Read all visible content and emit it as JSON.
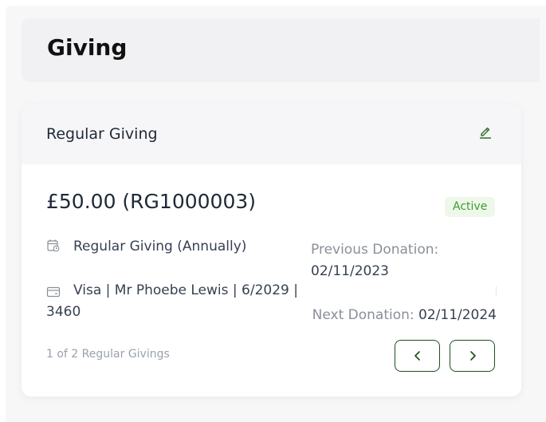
{
  "page": {
    "title": "Giving"
  },
  "card": {
    "title": "Regular Giving",
    "amount": "£50.00 (RG1000003)",
    "status": "Active",
    "frequency": "Regular Giving (Annually)",
    "payment_line1": "Visa | Mr Phoebe Lewis | 6/2029 |",
    "payment_line2": "3460",
    "previous_donation_label": "Previous Donation:",
    "previous_donation_value": "02/11/2023",
    "next_donation_label": "Next Donation:",
    "next_donation_value": "02/11/2024",
    "pager": {
      "position": "1 of 2",
      "label": "Regular Givings"
    }
  },
  "icons": {
    "edit": "pencil-icon",
    "calendar": "calendar-clock-icon",
    "card": "credit-card-icon",
    "prev": "chevron-left-icon",
    "next": "chevron-right-icon"
  },
  "colors": {
    "accent": "#1e4d1f",
    "status_bg": "#eef8ea",
    "status_text": "#3f9b2e"
  }
}
